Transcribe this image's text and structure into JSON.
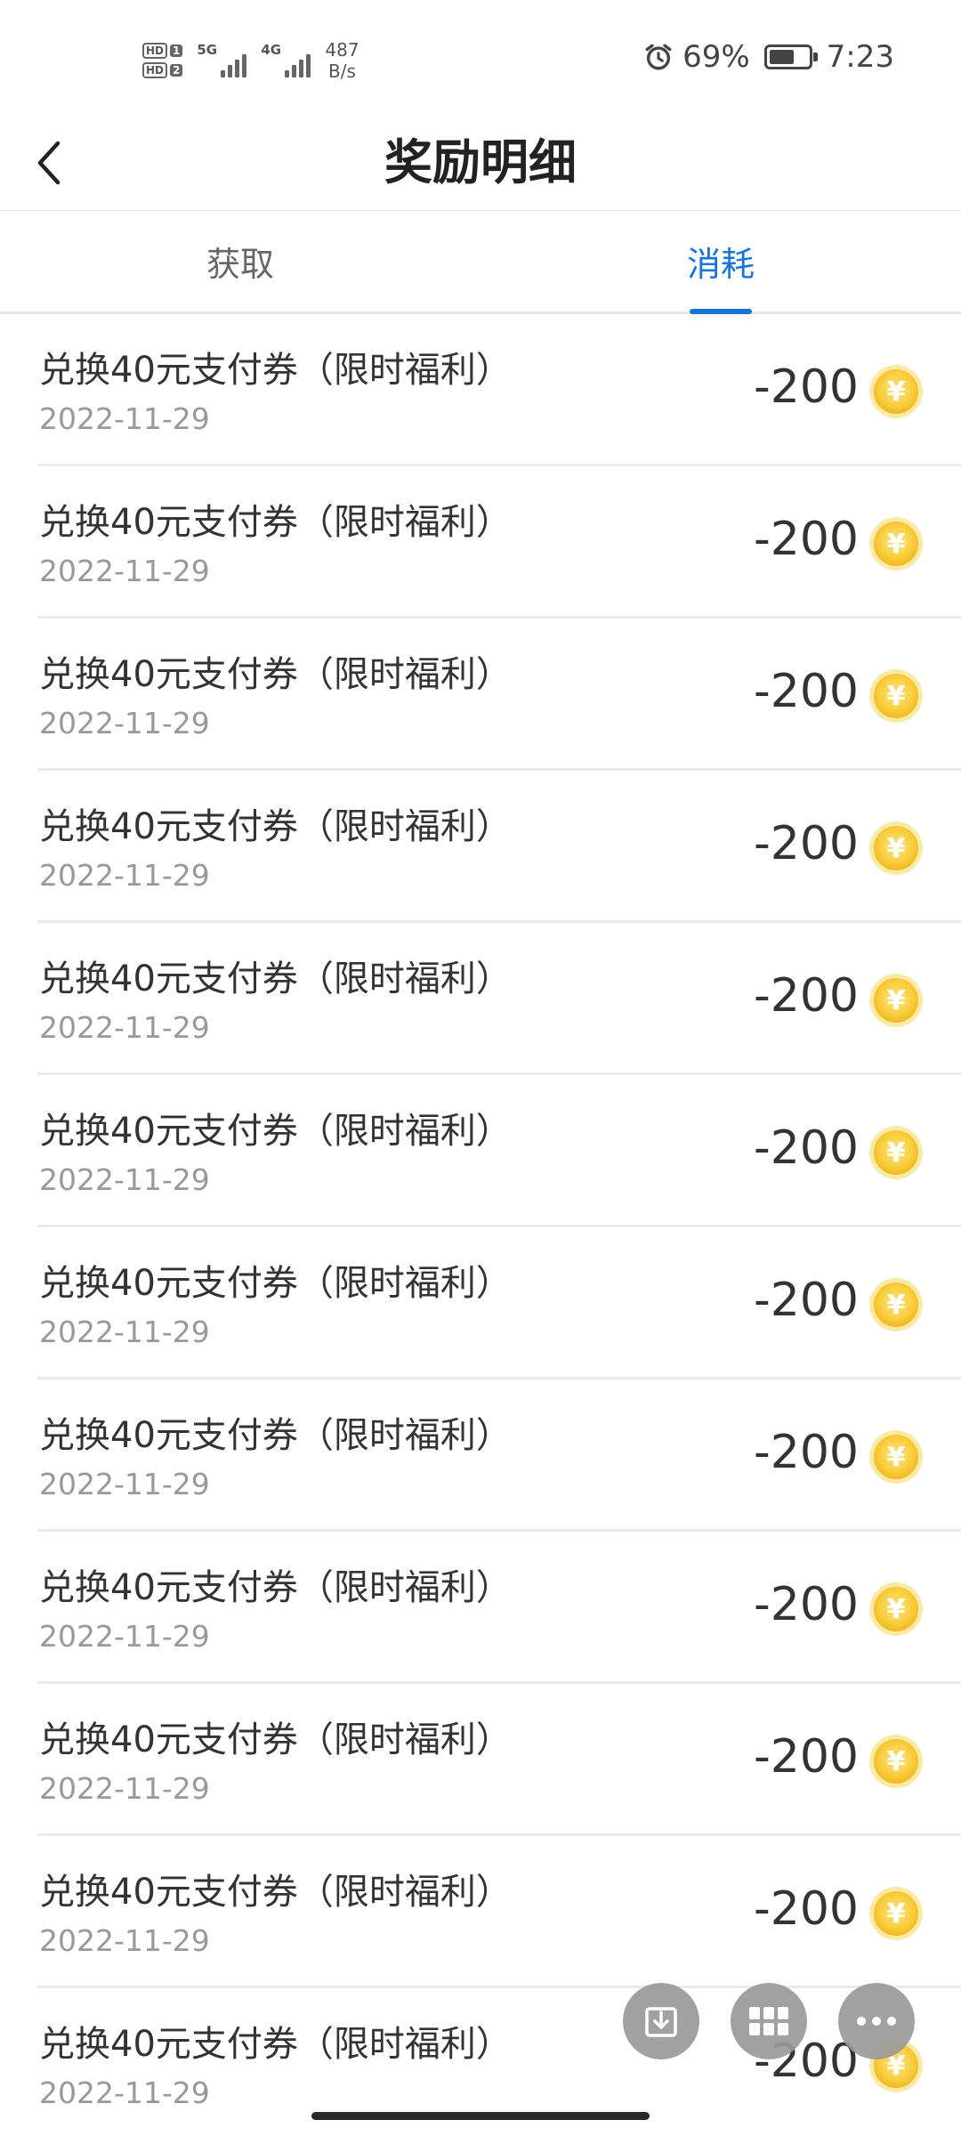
{
  "status_bar": {
    "sim1": "HD",
    "sim1_num": "1",
    "sim2": "HD",
    "sim2_num": "2",
    "net1": "5G",
    "net2": "4G",
    "speed_value": "487",
    "speed_unit": "B/s",
    "battery": "69%",
    "battery_level": 0.69,
    "time": "7:23"
  },
  "header": {
    "title": "奖励明细",
    "back_icon": "chevron-left-icon"
  },
  "tabs": [
    {
      "label": "获取",
      "active": false
    },
    {
      "label": "消耗",
      "active": true
    }
  ],
  "records": [
    {
      "title": "兑换40元支付券（限时福利）",
      "date": "2022-11-29",
      "amount": "-200"
    },
    {
      "title": "兑换40元支付券（限时福利）",
      "date": "2022-11-29",
      "amount": "-200"
    },
    {
      "title": "兑换40元支付券（限时福利）",
      "date": "2022-11-29",
      "amount": "-200"
    },
    {
      "title": "兑换40元支付券（限时福利）",
      "date": "2022-11-29",
      "amount": "-200"
    },
    {
      "title": "兑换40元支付券（限时福利）",
      "date": "2022-11-29",
      "amount": "-200"
    },
    {
      "title": "兑换40元支付券（限时福利）",
      "date": "2022-11-29",
      "amount": "-200"
    },
    {
      "title": "兑换40元支付券（限时福利）",
      "date": "2022-11-29",
      "amount": "-200"
    },
    {
      "title": "兑换40元支付券（限时福利）",
      "date": "2022-11-29",
      "amount": "-200"
    },
    {
      "title": "兑换40元支付券（限时福利）",
      "date": "2022-11-29",
      "amount": "-200"
    },
    {
      "title": "兑换40元支付券（限时福利）",
      "date": "2022-11-29",
      "amount": "-200"
    },
    {
      "title": "兑换40元支付券（限时福利）",
      "date": "2022-11-29",
      "amount": "-200"
    },
    {
      "title": "兑换40元支付券（限时福利）",
      "date": "2022-11-29",
      "amount": "-200"
    }
  ],
  "coin_symbol": "¥",
  "floating_buttons": [
    {
      "icon": "download-icon"
    },
    {
      "icon": "grid-icon"
    },
    {
      "icon": "more-icon"
    }
  ],
  "colors": {
    "accent": "#1a73d9",
    "coin": "#f6c93a",
    "text": "#333333",
    "subtext": "#999999"
  }
}
